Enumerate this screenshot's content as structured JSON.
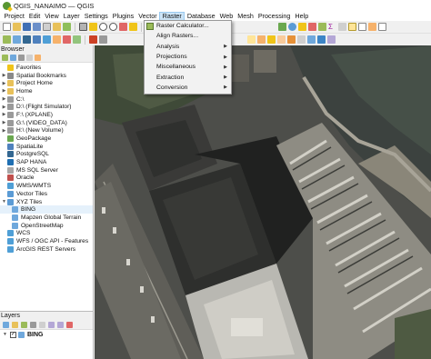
{
  "window": {
    "title": "QGIS_NANAIMO — QGIS"
  },
  "menubar": {
    "items": [
      {
        "label": "Project"
      },
      {
        "label": "Edit"
      },
      {
        "label": "View"
      },
      {
        "label": "Layer"
      },
      {
        "label": "Settings"
      },
      {
        "label": "Plugins"
      },
      {
        "label": "Vector"
      },
      {
        "label": "Raster"
      },
      {
        "label": "Database"
      },
      {
        "label": "Web"
      },
      {
        "label": "Mesh"
      },
      {
        "label": "Processing"
      },
      {
        "label": "Help"
      }
    ],
    "active": "Raster"
  },
  "raster_menu": {
    "items": [
      {
        "label": "Raster Calculator...",
        "submenu": false,
        "icon": "raster-calculator-icon"
      },
      {
        "label": "Align Rasters...",
        "submenu": false,
        "icon": ""
      },
      {
        "label": "Analysis",
        "submenu": true
      },
      {
        "label": "Projections",
        "submenu": true
      },
      {
        "label": "Miscellaneous",
        "submenu": true
      },
      {
        "label": "Extraction",
        "submenu": true
      },
      {
        "label": "Conversion",
        "submenu": true
      }
    ],
    "submenu_arrow": "▶"
  },
  "browser": {
    "title": "Browser",
    "items": [
      {
        "label": "Favorites",
        "icon": "star-icon",
        "color": "#f0c419",
        "expand": "",
        "indent": 0
      },
      {
        "label": "Spatial Bookmarks",
        "icon": "bookmark-icon",
        "color": "#8a8a8a",
        "expand": "▶",
        "indent": 0
      },
      {
        "label": "Project Home",
        "icon": "home-folder-icon",
        "color": "#e8c15a",
        "expand": "▶",
        "indent": 0
      },
      {
        "label": "Home",
        "icon": "home-folder-icon",
        "color": "#e8c15a",
        "expand": "▶",
        "indent": 0
      },
      {
        "label": "C:\\",
        "icon": "drive-icon",
        "color": "#9a9a9a",
        "expand": "▶",
        "indent": 0
      },
      {
        "label": "D:\\ (Flight Simulator)",
        "icon": "drive-icon",
        "color": "#9a9a9a",
        "expand": "▶",
        "indent": 0
      },
      {
        "label": "F:\\ (XPLANE)",
        "icon": "drive-icon",
        "color": "#9a9a9a",
        "expand": "▶",
        "indent": 0
      },
      {
        "label": "G:\\ (VIDEO_DATA)",
        "icon": "drive-icon",
        "color": "#9a9a9a",
        "expand": "▶",
        "indent": 0
      },
      {
        "label": "H:\\ (New Volume)",
        "icon": "drive-icon",
        "color": "#9a9a9a",
        "expand": "▶",
        "indent": 0
      },
      {
        "label": "GeoPackage",
        "icon": "geopackage-icon",
        "color": "#6aa84f",
        "expand": "",
        "indent": 0
      },
      {
        "label": "SpatiaLite",
        "icon": "spatialite-icon",
        "color": "#4f81bd",
        "expand": "",
        "indent": 0
      },
      {
        "label": "PostgreSQL",
        "icon": "postgresql-icon",
        "color": "#336791",
        "expand": "",
        "indent": 0
      },
      {
        "label": "SAP HANA",
        "icon": "sap-hana-icon",
        "color": "#1f6fb2",
        "expand": "",
        "indent": 0
      },
      {
        "label": "MS SQL Server",
        "icon": "mssql-icon",
        "color": "#a6a6a6",
        "expand": "",
        "indent": 0
      },
      {
        "label": "Oracle",
        "icon": "oracle-icon",
        "color": "#c0504d",
        "expand": "",
        "indent": 0
      },
      {
        "label": "WMS/WMTS",
        "icon": "wms-icon",
        "color": "#4f9fd6",
        "expand": "",
        "indent": 0
      },
      {
        "label": "Vector Tiles",
        "icon": "vector-tiles-icon",
        "color": "#5b9bd5",
        "expand": "",
        "indent": 0
      },
      {
        "label": "XYZ Tiles",
        "icon": "xyz-tiles-icon",
        "color": "#5b9bd5",
        "expand": "▼",
        "indent": 0
      },
      {
        "label": "BING",
        "icon": "tile-layer-icon",
        "color": "#6fa8dc",
        "expand": "",
        "indent": 1,
        "selected": true
      },
      {
        "label": "Mapzen Global Terrain",
        "icon": "tile-layer-icon",
        "color": "#6fa8dc",
        "expand": "",
        "indent": 1
      },
      {
        "label": "OpenStreetMap",
        "icon": "tile-layer-icon",
        "color": "#6fa8dc",
        "expand": "",
        "indent": 1
      },
      {
        "label": "WCS",
        "icon": "wcs-icon",
        "color": "#4f9fd6",
        "expand": "",
        "indent": 0
      },
      {
        "label": "WFS / OGC API - Features",
        "icon": "wfs-icon",
        "color": "#4f9fd6",
        "expand": "",
        "indent": 0
      },
      {
        "label": "ArcGIS REST Servers",
        "icon": "arcgis-icon",
        "color": "#4f9fd6",
        "expand": "",
        "indent": 0
      }
    ]
  },
  "layers": {
    "title": "Layers",
    "items": [
      {
        "label": "BING",
        "checked": true,
        "check_mark": "✓",
        "expand": "▼"
      }
    ]
  },
  "colors": {
    "menu_highlight": "#cce4f7",
    "selection": "#e5f1fb"
  }
}
